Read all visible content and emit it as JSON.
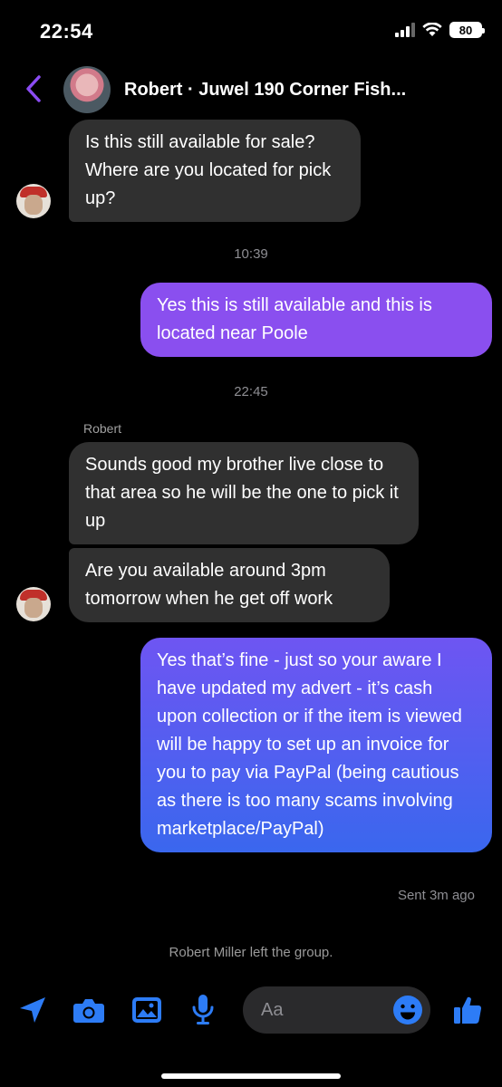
{
  "status": {
    "time": "22:54",
    "battery": "80"
  },
  "header": {
    "title": "Robert · Juwel 190 Corner Fish..."
  },
  "messages": [
    {
      "text": "Is this still available for sale? Where are you located for pick up?"
    },
    {
      "text": "Yes this is still available and this is located near Poole"
    },
    {
      "text": "Sounds good my brother live close to that area so he will be the one to pick it up"
    },
    {
      "text": "Are you available around 3pm tomorrow when he get off work"
    },
    {
      "text": "Yes that’s fine - just so your aware I have updated my advert - it’s cash upon collection or if the item is viewed will be happy to set up an invoice for you to pay via PayPal (being cautious as there is too many scams involving marketplace/PayPal)"
    }
  ],
  "timestamps": [
    "10:39",
    "22:45"
  ],
  "sender_name": "Robert",
  "sent_status": "Sent 3m ago",
  "system_message": "Robert Miller left the group.",
  "composer": {
    "placeholder": "Aa"
  },
  "icons": [
    "back-chevron-icon",
    "location-arrow-icon",
    "camera-icon",
    "photo-icon",
    "microphone-icon",
    "emoji-icon",
    "thumbs-up-icon"
  ],
  "colors": {
    "accent": "#7b4cf0",
    "outgoing_top": "#8a4fef",
    "outgoing_bottom": "#3a67ee",
    "incoming": "#303030",
    "icon_blue": "#2d7cf6"
  }
}
